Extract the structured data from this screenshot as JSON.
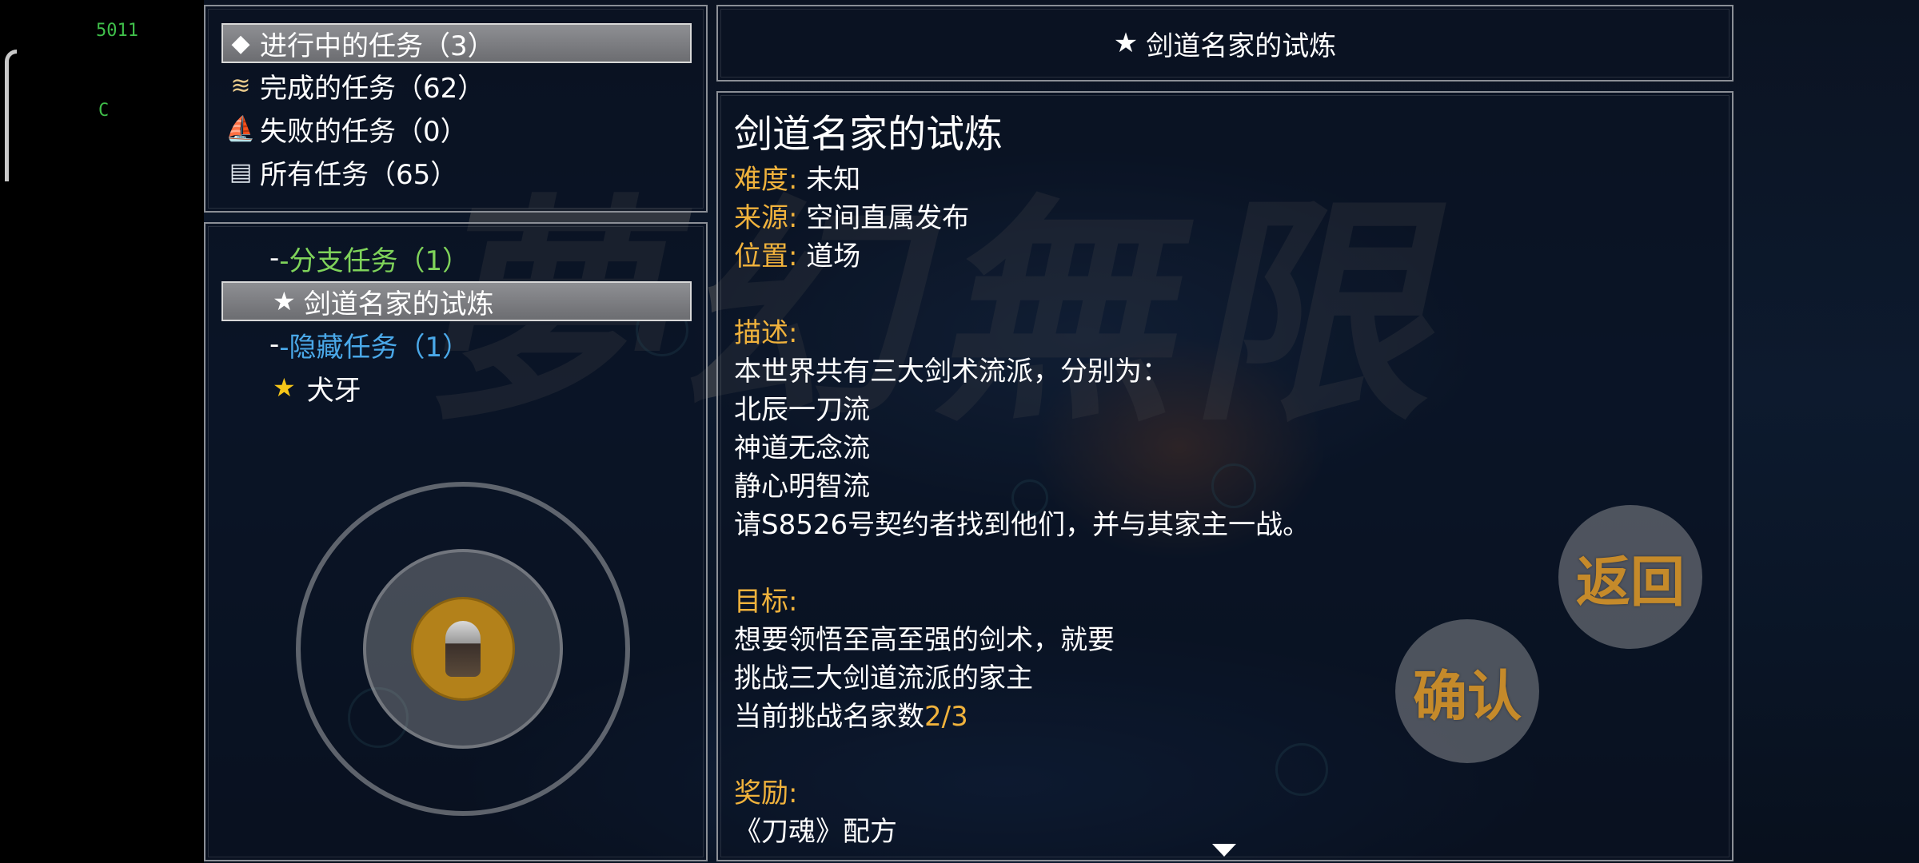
{
  "system": {
    "counter": "5011",
    "letter": "C"
  },
  "categories": [
    {
      "icon": "card-icon",
      "glyph": "◆",
      "label": "进行中的任务（3）",
      "selected": true
    },
    {
      "icon": "scroll-icon",
      "glyph": "📜",
      "label": "完成的任务（62）",
      "selected": false
    },
    {
      "icon": "flag-icon",
      "glyph": "⚠",
      "label": "失败的任务（0）",
      "selected": false
    },
    {
      "icon": "book-icon",
      "glyph": "📖",
      "label": "所有任务（65）",
      "selected": false
    }
  ],
  "quest_tree": {
    "branch_header": "-分支任务（1）",
    "branch_quest": "剑道名家的试炼",
    "hidden_header": "-隐藏任务（1）",
    "hidden_quest": "犬牙"
  },
  "detail": {
    "header_title": "剑道名家的试炼",
    "title": "剑道名家的试炼",
    "difficulty_label": "难度:",
    "difficulty": "未知",
    "source_label": "来源:",
    "source": "空间直属发布",
    "location_label": "位置:",
    "location": "道场",
    "desc_label": "描述:",
    "desc_lines": [
      "本世界共有三大剑术流派，分别为：",
      "北辰一刀流",
      "神道无念流",
      "静心明智流",
      "请S8526号契约者找到他们，并与其家主一战。"
    ],
    "goal_label": "目标:",
    "goal_lines": [
      "想要领悟至高至强的剑术，就要",
      "挑战三大剑道流派的家主"
    ],
    "goal_progress_text": "当前挑战名家数",
    "goal_progress_value": "2/3",
    "reward_label": "奖励:",
    "reward": "《刀魂》配方"
  },
  "buttons": {
    "back": "返回",
    "confirm": "确认"
  },
  "colors": {
    "branch": "#7fd35a",
    "hidden": "#4aa8e8",
    "label": "#f0b23c",
    "button_text": "#c58a2a"
  }
}
